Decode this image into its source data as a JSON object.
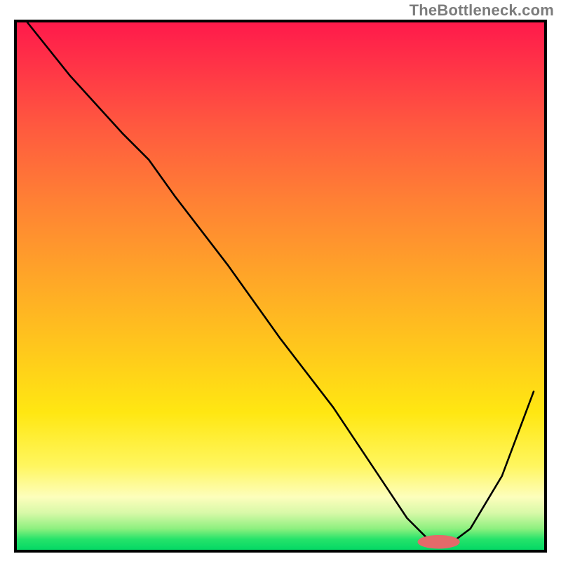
{
  "watermark": "TheBottleneck.com",
  "colors": {
    "border": "#000000",
    "curve": "#000000",
    "marker": "#e46a6a",
    "gradient_top": "#ff1a4b",
    "gradient_bottom": "#05d865"
  },
  "chart_data": {
    "type": "line",
    "title": "",
    "xlabel": "",
    "ylabel": "",
    "xlim": [
      0,
      100
    ],
    "ylim": [
      0,
      100
    ],
    "grid": false,
    "legend": false,
    "note": "Axes have no tick labels in the source image; numeric values below are estimated from geometry on a 0–100 normalized scale for each axis.",
    "series": [
      {
        "name": "bottleneck-curve",
        "x": [
          2,
          10,
          20,
          25,
          30,
          40,
          50,
          60,
          68,
          74,
          78,
          82,
          86,
          92,
          98
        ],
        "values": [
          100,
          90,
          79,
          74,
          67,
          54,
          40,
          27,
          15,
          6,
          2,
          1,
          4,
          14,
          30
        ]
      }
    ],
    "marker": {
      "name": "optimal-range",
      "x_start": 76,
      "x_end": 84,
      "y": 1.5
    }
  }
}
